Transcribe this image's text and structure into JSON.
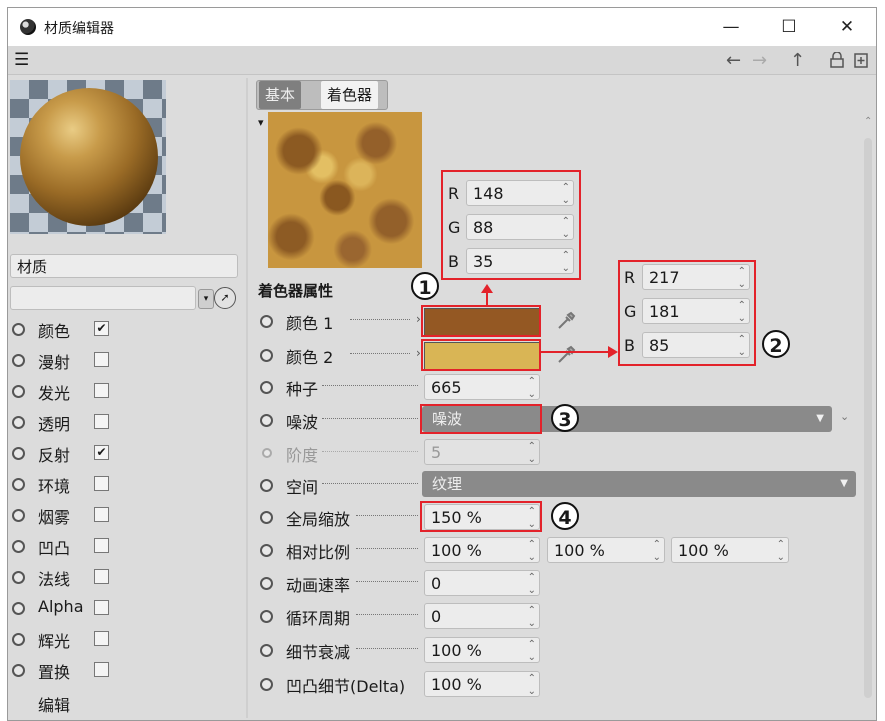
{
  "window": {
    "title": "材质编辑器",
    "controls": [
      "—",
      "☐",
      "✕"
    ]
  },
  "menubar": {
    "menu_icon": "hamburger-icon",
    "nav": [
      "←",
      "→",
      "↑"
    ]
  },
  "sidebar": {
    "material_name": "材质",
    "channels": [
      {
        "label": "颜色",
        "checked": true
      },
      {
        "label": "漫射",
        "checked": false
      },
      {
        "label": "发光",
        "checked": false
      },
      {
        "label": "透明",
        "checked": false
      },
      {
        "label": "反射",
        "checked": true
      },
      {
        "label": "环境",
        "checked": false
      },
      {
        "label": "烟雾",
        "checked": false
      },
      {
        "label": "凹凸",
        "checked": false
      },
      {
        "label": "法线",
        "checked": false
      },
      {
        "label": "Alpha",
        "checked": false
      },
      {
        "label": "辉光",
        "checked": false
      },
      {
        "label": "置换",
        "checked": false
      }
    ],
    "edit_label": "编辑"
  },
  "tabs": [
    "基本",
    "着色器"
  ],
  "rgb1": {
    "r": "148",
    "g": "88",
    "b": "35",
    "labels": [
      "R",
      "G",
      "B"
    ]
  },
  "rgb2": {
    "r": "217",
    "g": "181",
    "b": "85",
    "labels": [
      "R",
      "G",
      "B"
    ]
  },
  "shader": {
    "section_title": "着色器属性",
    "color1_label": "颜色 1",
    "color2_label": "颜色 2",
    "seed_label": "种子",
    "seed_value": "665",
    "noise_label": "噪波",
    "noise_value": "噪波",
    "octaves_label": "阶度",
    "octaves_value": "5",
    "space_label": "空间",
    "space_value": "纹理",
    "global_scale_label": "全局缩放",
    "global_scale_value": "150 %",
    "relative_scale_label": "相对比例",
    "relative_scale_values": [
      "100 %",
      "100 %",
      "100 %"
    ],
    "anim_speed_label": "动画速率",
    "anim_speed_value": "0",
    "loop_period_label": "循环周期",
    "loop_period_value": "0",
    "detail_att_label": "细节衰减",
    "detail_att_value": "100 %",
    "delta_label": "凹凸细节(Delta)",
    "delta_value": "100 %"
  },
  "colors": {
    "color1": "#945823",
    "color2": "#d9b555",
    "annotation": "#e3222a"
  },
  "annotations": [
    "1",
    "2",
    "3",
    "4"
  ]
}
